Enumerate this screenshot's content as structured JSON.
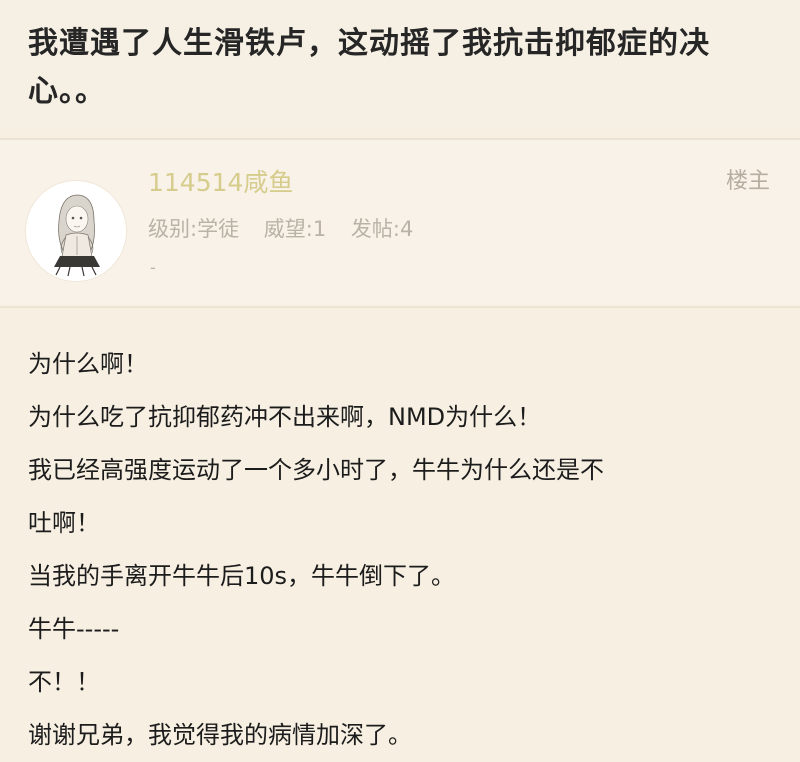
{
  "thread": {
    "title": "我遭遇了人生滑铁卢，这动摇了我抗击抑郁症的决心。。"
  },
  "author": {
    "username": "114514咸鱼",
    "badge": "楼主",
    "level_label": "级别:学徒",
    "reputation_label": "威望:1",
    "posts_label": "发帖:4",
    "signature": "-"
  },
  "post": {
    "lines": [
      "为什么啊！",
      "为什么吃了抗抑郁药冲不出来啊，NMD为什么！",
      "我已经高强度运动了一个多小时了，牛牛为什么还是不",
      "吐啊！",
      "当我的手离开牛牛后10s，牛牛倒下了。",
      "牛牛-----",
      "不！！",
      "谢谢兄弟，我觉得我的病情加深了。"
    ]
  },
  "colors": {
    "background": "#f6efe2",
    "username": "#d6cc8c",
    "meta_text": "#b9b2a6",
    "body_text": "#1c1c1c"
  }
}
